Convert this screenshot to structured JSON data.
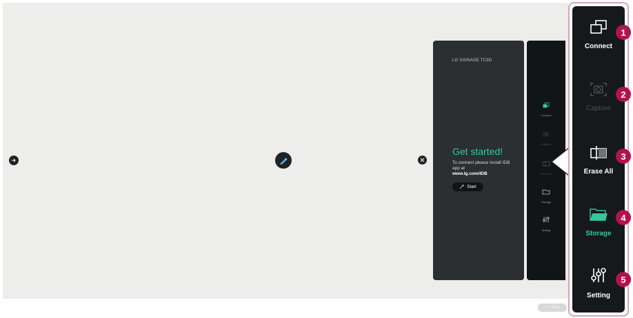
{
  "panel": {
    "brand": "LG SIGNAGE TC3D",
    "title": "Get started!",
    "desc": "To connect please install IDB app at",
    "url": "www.lg.com/IDB",
    "start_label": "Start"
  },
  "mini_menu": [
    {
      "label": "Connect",
      "icon": "connect-icon",
      "state": "active"
    },
    {
      "label": "Capture",
      "icon": "capture-icon",
      "state": "disabled"
    },
    {
      "label": "Erase All",
      "icon": "erase-all-icon",
      "state": "disabled"
    },
    {
      "label": "Storage",
      "icon": "storage-icon",
      "state": "normal"
    },
    {
      "label": "Setting",
      "icon": "setting-icon",
      "state": "normal"
    }
  ],
  "big_menu": [
    {
      "label": "Connect",
      "icon": "connect-icon",
      "state": "normal",
      "callout": "1"
    },
    {
      "label": "Capture",
      "icon": "capture-icon",
      "state": "disabled",
      "callout": "2"
    },
    {
      "label": "Erase All",
      "icon": "erase-all-icon",
      "state": "normal",
      "callout": "3"
    },
    {
      "label": "Storage",
      "icon": "storage-icon",
      "state": "active",
      "callout": "4"
    },
    {
      "label": "Setting",
      "icon": "setting-icon",
      "state": "normal",
      "callout": "5"
    }
  ],
  "bottom_start_label": "Start",
  "colors": {
    "accent": "#36c7a0",
    "callout": "#b0144a",
    "panel": "#2b2f31",
    "bar": "#16191b"
  }
}
